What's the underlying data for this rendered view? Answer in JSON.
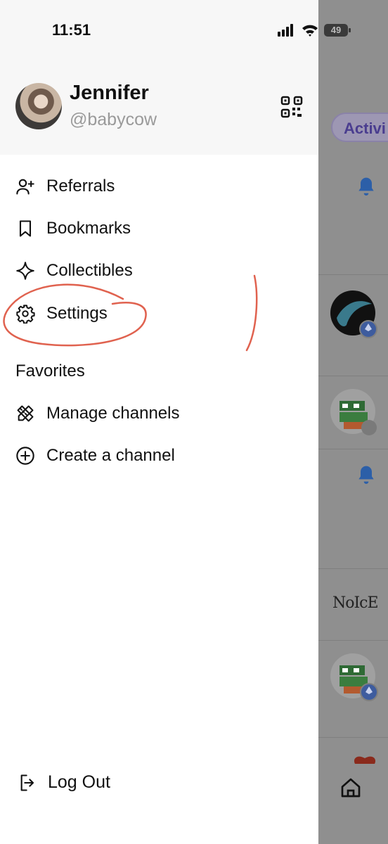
{
  "status_bar": {
    "time": "11:51",
    "battery": "49"
  },
  "profile": {
    "name": "Jennifer",
    "handle": "@babycow"
  },
  "menu": [
    {
      "label": "Referrals",
      "icon": "add-user-icon"
    },
    {
      "label": "Bookmarks",
      "icon": "bookmark-icon"
    },
    {
      "label": "Collectibles",
      "icon": "sparkle-icon"
    },
    {
      "label": "Settings",
      "icon": "gear-icon"
    }
  ],
  "favorites": {
    "title": "Favorites",
    "items": [
      {
        "label": "Manage channels",
        "icon": "pencil-ruler-icon"
      },
      {
        "label": "Create a channel",
        "icon": "plus-circle-icon"
      }
    ]
  },
  "logout": {
    "label": "Log Out",
    "icon": "logout-icon"
  },
  "background_app": {
    "tab_label": "Activi",
    "text_post": "NoIcE"
  },
  "annotation": {
    "color": "#e0624f",
    "target": "Settings"
  }
}
